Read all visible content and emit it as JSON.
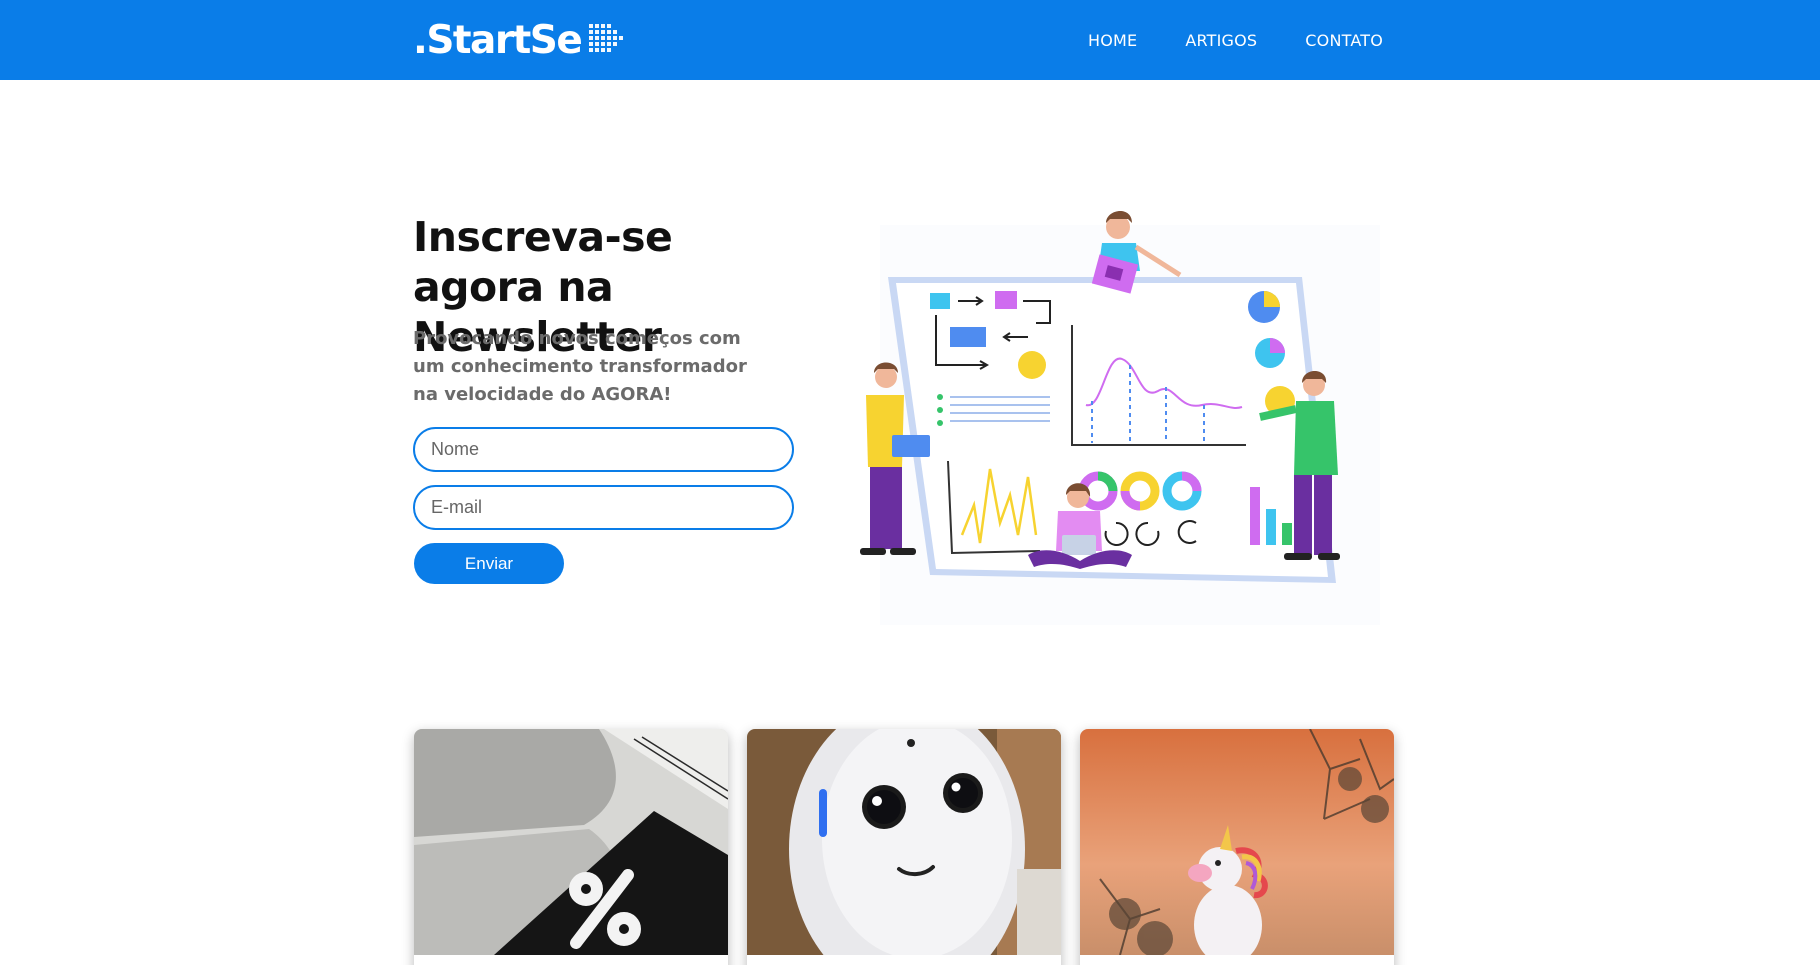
{
  "header": {
    "logo_text": ".StartSe",
    "nav": [
      {
        "label": "HOME"
      },
      {
        "label": "ARTIGOS"
      },
      {
        "label": "CONTATO"
      }
    ]
  },
  "hero": {
    "title": "Inscreva-se agora na Newsletter",
    "subtitle": "Provocando novos começos com um conhecimento transformador na velocidade do AGORA!",
    "form": {
      "name_placeholder": "Nome",
      "email_placeholder": "E-mail",
      "submit_label": "Enviar"
    },
    "illustration_icon": "analytics-team-illustration"
  },
  "cards": [
    {
      "image_icon": "percent-sign-image"
    },
    {
      "image_icon": "robot-image"
    },
    {
      "image_icon": "unicorn-image"
    }
  ],
  "colors": {
    "brand": "#0a7de8",
    "background": "#ffffff",
    "heading": "#111111",
    "subtitle": "#6b6b6b"
  }
}
